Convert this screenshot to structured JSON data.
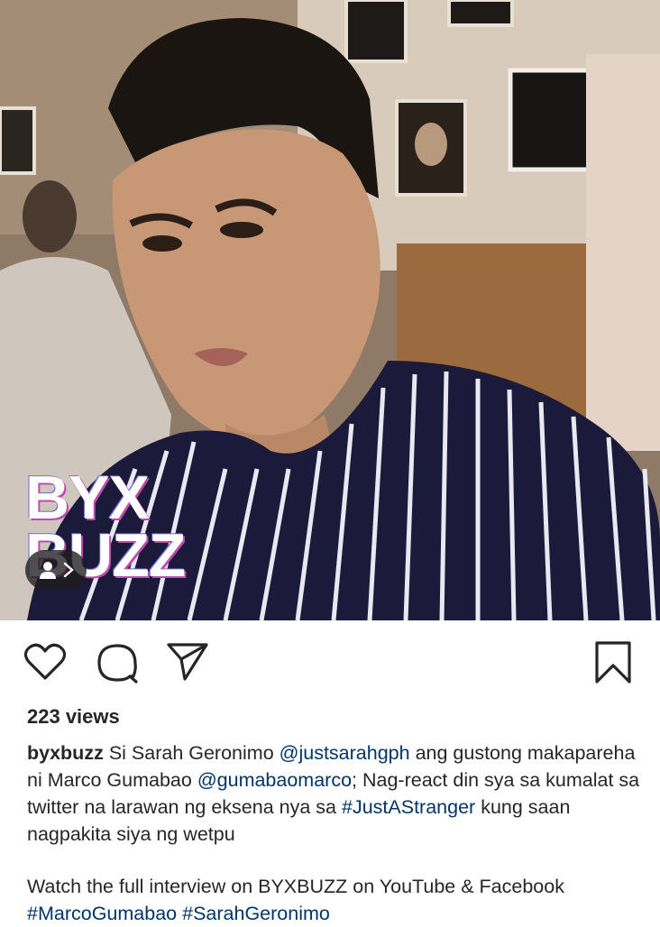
{
  "post": {
    "watermark_line1": "BYX",
    "watermark_line2": "BUZZ",
    "views": "223 views",
    "caption": {
      "username": "byxbuzz",
      "part1": "Si Sarah Geronimo",
      "mention1": "@justsarahgph",
      "part2": "ang gustong makapareha ni Marco Gumabao",
      "mention2": "@gumabaomarco",
      "part3": "; Nag-react din sya sa kumalat sa twitter na larawan ng eksena nya sa",
      "hashtag1": "#JustAStranger",
      "part4": "kung saan nagpakita siya ng wetpu",
      "part5": "Watch the full interview on BYXBUZZ on YouTube & Facebook",
      "hashtag2": "#MarcoGumabao",
      "hashtag3": "#SarahGeronimo"
    }
  },
  "colors": {
    "link": "#003569",
    "text": "#262626"
  },
  "icons": [
    "heart-icon",
    "comment-icon",
    "share-icon",
    "bookmark-icon",
    "user-tag-icon",
    "chevron-right-icon"
  ]
}
